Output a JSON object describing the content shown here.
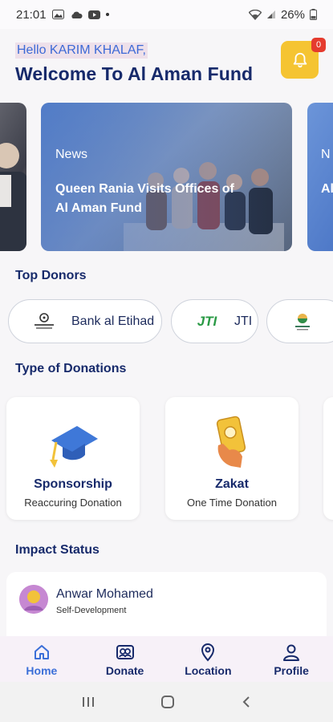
{
  "status_bar": {
    "time": "21:01",
    "battery": "26%"
  },
  "header": {
    "greeting": "Hello KARIM KHALAF,",
    "welcome": "Welcome To Al Aman Fund",
    "notification_count": "0"
  },
  "news": [
    {
      "category": "News",
      "title": "Queen Rania Visits Offices of Al Aman Fund"
    },
    {
      "category": "N",
      "title": "Al of"
    }
  ],
  "sections": {
    "top_donors": "Top Donors",
    "types": "Type of Donations",
    "impact": "Impact Status"
  },
  "donors": [
    {
      "name": "Bank al Etihad"
    },
    {
      "name": "JTI",
      "logo_text": "JTI"
    }
  ],
  "donation_types": [
    {
      "name": "Sponsorship",
      "subtitle": "Reaccuring Donation"
    },
    {
      "name": "Zakat",
      "subtitle": "One Time Donation"
    }
  ],
  "impact": {
    "name": "Anwar Mohamed",
    "subtitle": "Self-Development"
  },
  "nav": [
    {
      "label": "Home",
      "icon": "home-icon"
    },
    {
      "label": "Donate",
      "icon": "donate-icon"
    },
    {
      "label": "Location",
      "icon": "location-icon"
    },
    {
      "label": "Profile",
      "icon": "profile-icon"
    }
  ],
  "colors": {
    "accent": "#3b6fd8",
    "primary_text": "#172a6b",
    "bell": "#f5c432",
    "badge": "#e53b2e"
  }
}
